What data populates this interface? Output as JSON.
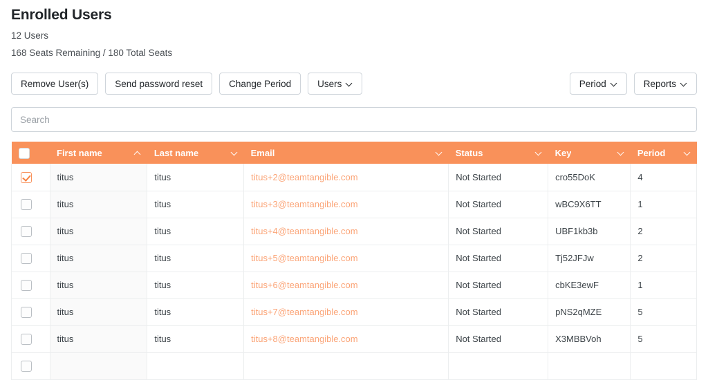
{
  "header": {
    "title": "Enrolled Users",
    "user_count_line": "12 Users",
    "seats_line": "168 Seats Remaining / 180 Total Seats"
  },
  "toolbar": {
    "remove_users_label": "Remove User(s)",
    "send_password_reset_label": "Send password reset",
    "change_period_label": "Change Period",
    "users_dropdown_label": "Users",
    "period_dropdown_label": "Period",
    "reports_dropdown_label": "Reports"
  },
  "search": {
    "placeholder": "Search",
    "value": ""
  },
  "table": {
    "columns": [
      {
        "label": "First name",
        "sort": "asc"
      },
      {
        "label": "Last name",
        "sort": "none"
      },
      {
        "label": "Email",
        "sort": "none"
      },
      {
        "label": "Status",
        "sort": "none"
      },
      {
        "label": "Key",
        "sort": "none"
      },
      {
        "label": "Period",
        "sort": "none"
      }
    ],
    "select_all_checked": false,
    "rows": [
      {
        "selected": true,
        "first_name": "titus",
        "last_name": "titus",
        "email": "titus+2@teamtangible.com",
        "status": "Not Started",
        "key": "cro55DoK",
        "period": "4"
      },
      {
        "selected": false,
        "first_name": "titus",
        "last_name": "titus",
        "email": "titus+3@teamtangible.com",
        "status": "Not Started",
        "key": "wBC9X6TT",
        "period": "1"
      },
      {
        "selected": false,
        "first_name": "titus",
        "last_name": "titus",
        "email": "titus+4@teamtangible.com",
        "status": "Not Started",
        "key": "UBF1kb3b",
        "period": "2"
      },
      {
        "selected": false,
        "first_name": "titus",
        "last_name": "titus",
        "email": "titus+5@teamtangible.com",
        "status": "Not Started",
        "key": "Tj52JFJw",
        "period": "2"
      },
      {
        "selected": false,
        "first_name": "titus",
        "last_name": "titus",
        "email": "titus+6@teamtangible.com",
        "status": "Not Started",
        "key": "cbKE3ewF",
        "period": "1"
      },
      {
        "selected": false,
        "first_name": "titus",
        "last_name": "titus",
        "email": "titus+7@teamtangible.com",
        "status": "Not Started",
        "key": "pNS2qMZE",
        "period": "5"
      },
      {
        "selected": false,
        "first_name": "titus",
        "last_name": "titus",
        "email": "titus+8@teamtangible.com",
        "status": "Not Started",
        "key": "X3MBBVoh",
        "period": "5"
      },
      {
        "selected": false,
        "first_name": "",
        "last_name": "",
        "email": "",
        "status": "",
        "key": "",
        "period": ""
      }
    ]
  },
  "colors": {
    "header_orange": "#f9915a",
    "email_link": "#fba477",
    "checkbox_accent": "#f7803f",
    "border": "#eceeef",
    "button_border": "#ced4da"
  }
}
